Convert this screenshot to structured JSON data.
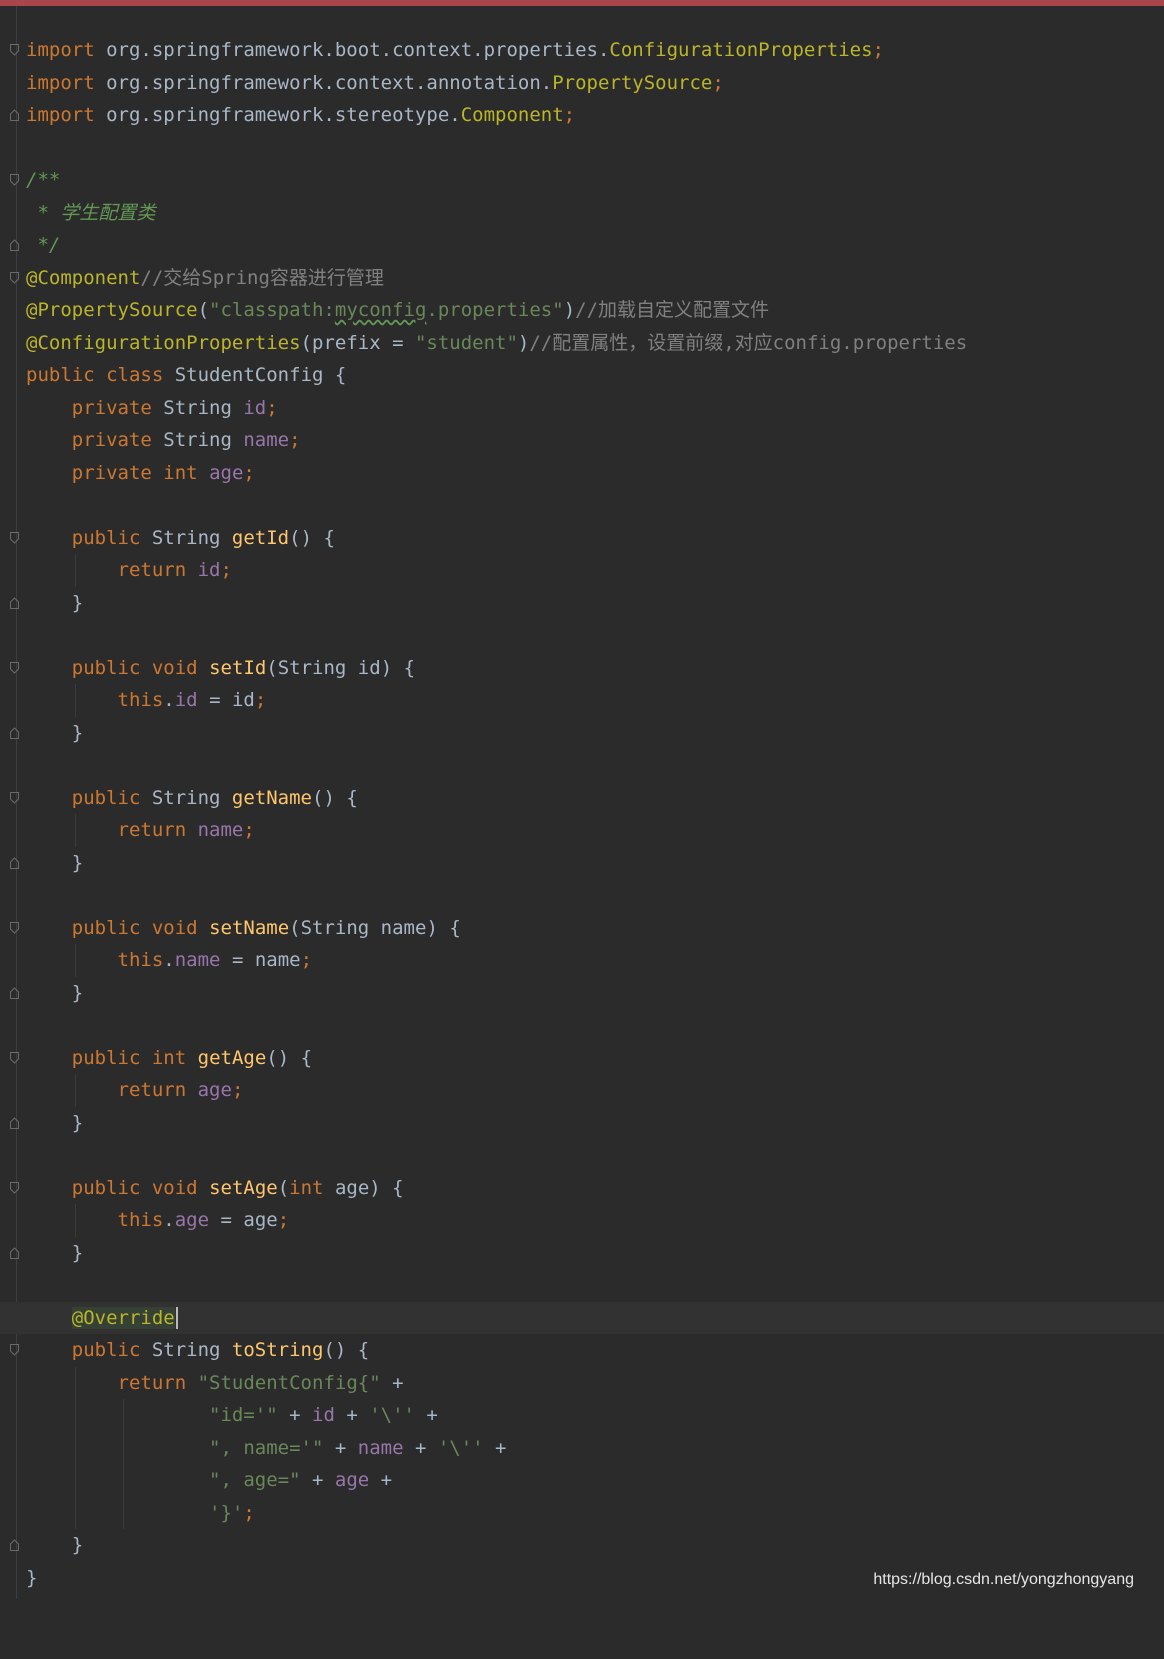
{
  "editor": {
    "tokens": {
      "import": "import",
      "pkg_ctx_props": "org.springframework.boot.context.properties.",
      "ConfigurationProperties": "ConfigurationProperties",
      "semi": ";",
      "pkg_ctx_anno": "org.springframework.context.annotation.",
      "PropertySource": "PropertySource",
      "pkg_stereo": "org.springframework.stereotype.",
      "Component": "Component",
      "doc_open": "/**",
      "doc_body": " * 学生配置类",
      "doc_close": " */",
      "anno_component": "@Component",
      "cmt_component": "//交给Spring容器进行管理",
      "anno_propsource": "@PropertySource",
      "lparen": "(",
      "rparen": ")",
      "str_classpath_a": "\"classpath:",
      "str_myconfig": "myconfig",
      "str_classpath_b": ".properties\"",
      "cmt_propsource": "//加载自定义配置文件",
      "anno_confprops": "@ConfigurationProperties",
      "prefix": "prefix = ",
      "str_student": "\"student\"",
      "cmt_confprops": "//配置属性，设置前缀,对应config.properties",
      "public": "public",
      "class": "class",
      "class_name": " StudentConfig {",
      "private": "private",
      "String": " String ",
      "int": "int",
      "id": "id",
      "name": "name",
      "age": "age",
      "getId": "getId",
      "setId": "setId",
      "getName": "getName",
      "setName": "setName",
      "getAge": "getAge",
      "setAge": "setAge",
      "toString": "toString",
      "void": "void",
      "return": "return",
      "this": "this",
      "dot": ".",
      "assign": " = ",
      "parens_open": "() {",
      "close_brace": "}",
      "param_string": "(String ",
      "param_int_open": "(",
      "paren_brace": ") {",
      "anno_override": "@Override",
      "str_sc": "\"StudentConfig{\"",
      "plus": " +",
      "str_id": "\"id='\"",
      "plus_mid": " + ",
      "char_quote": "'\\''",
      "str_name": "\", name='\"",
      "str_age": "\", age=\"",
      "char_close": "'}'"
    }
  },
  "watermark": "https://blog.csdn.net/yongzhongyang"
}
